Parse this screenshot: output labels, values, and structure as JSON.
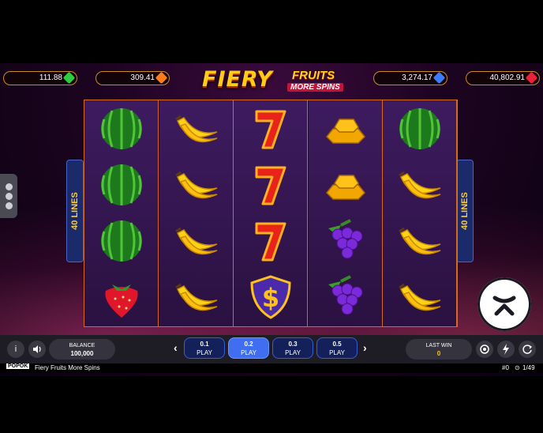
{
  "game": {
    "title": "Fiery Fruits More Spins",
    "logo_main": "FIERY",
    "logo_sub": "FRUITS",
    "logo_tag": "MORE SPINS",
    "provider": "POPOK"
  },
  "jackpots": [
    {
      "value": "111.88",
      "gem": "green-gem-icon",
      "color": "#2ecc40"
    },
    {
      "value": "309.41",
      "gem": "orange-gem-icon",
      "color": "#ff7a1a"
    },
    {
      "value": "3,274.17",
      "gem": "blue-gem-icon",
      "color": "#3a7bff"
    },
    {
      "value": "40,802.91",
      "gem": "red-gem-icon",
      "color": "#e8223a"
    }
  ],
  "lines_label": "40 LINES",
  "reels": [
    [
      "watermelon",
      "watermelon",
      "watermelon",
      "strawberry"
    ],
    [
      "banana",
      "banana",
      "banana",
      "banana"
    ],
    [
      "seven",
      "seven",
      "seven",
      "dollar-shield"
    ],
    [
      "gold-bars",
      "gold-bars",
      "grapes",
      "grapes"
    ],
    [
      "watermelon",
      "banana",
      "banana",
      "banana"
    ]
  ],
  "controls": {
    "info": "i",
    "balance_label": "BALANCE",
    "balance_value": "100,000",
    "bets": [
      {
        "value": "0.1",
        "label": "PLAY",
        "selected": false
      },
      {
        "value": "0.2",
        "label": "PLAY",
        "selected": true
      },
      {
        "value": "0.3",
        "label": "PLAY",
        "selected": false
      },
      {
        "value": "0.5",
        "label": "PLAY",
        "selected": false
      }
    ],
    "last_win_label": "LAST WIN",
    "last_win_value": "0"
  },
  "footer": {
    "round": "#0",
    "clock": "1/49"
  }
}
